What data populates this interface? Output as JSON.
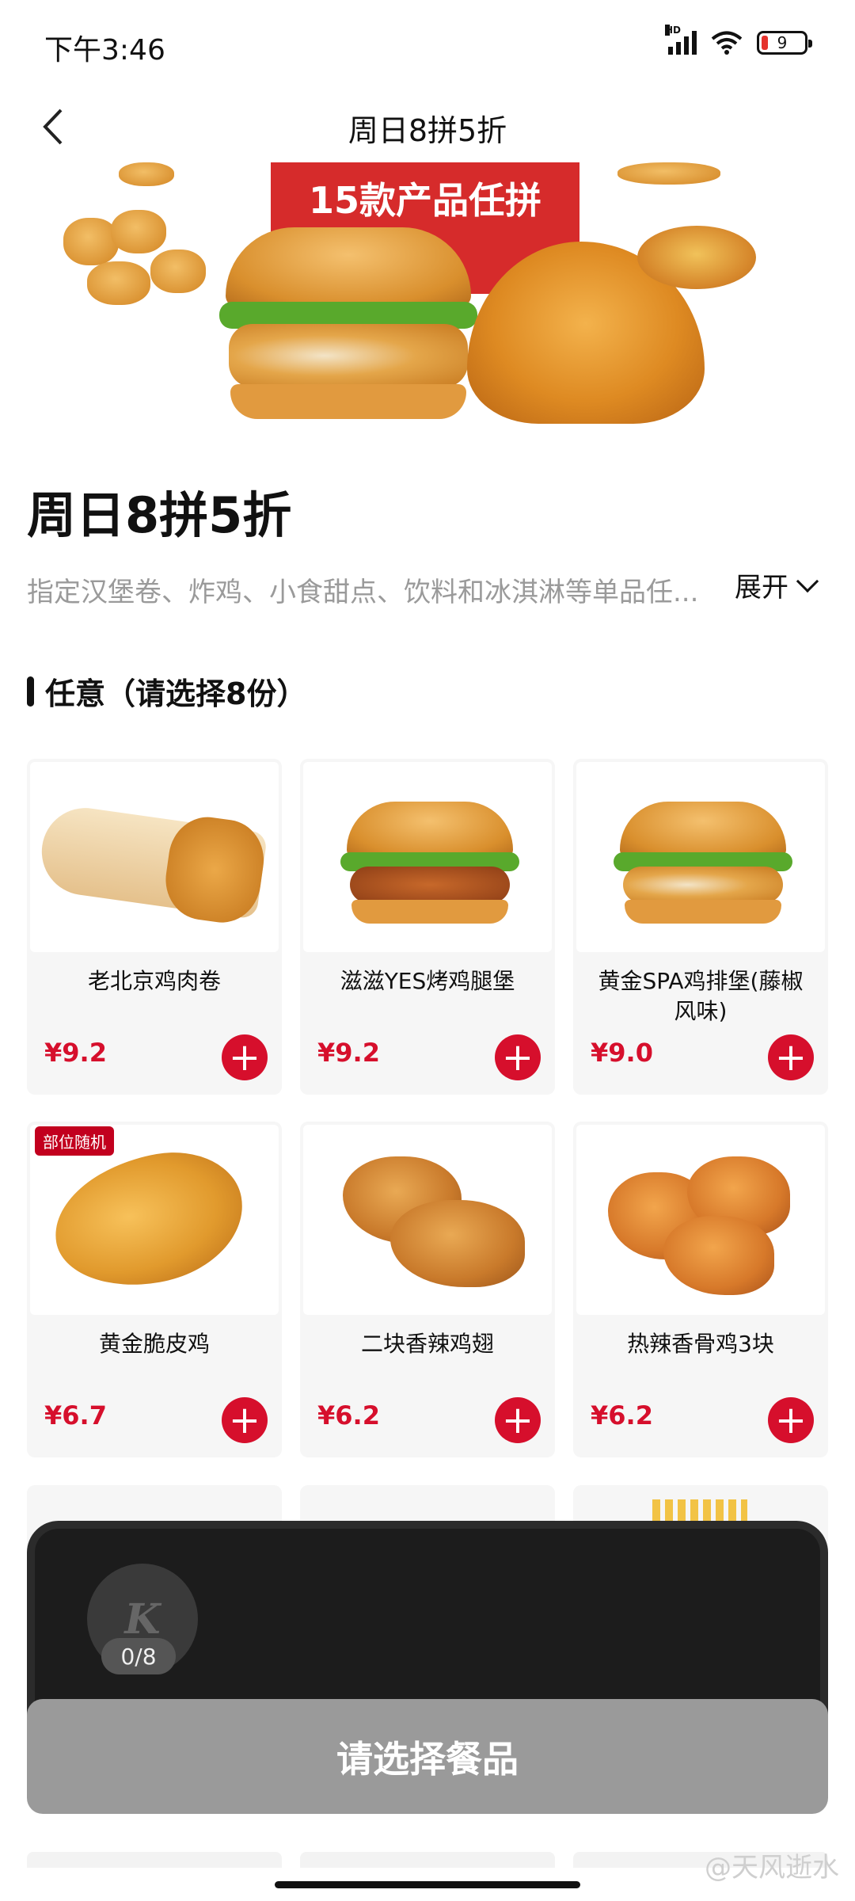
{
  "status_bar": {
    "time": "下午3:46",
    "network": "HD",
    "battery": "9"
  },
  "nav": {
    "title": "周日8拼5折"
  },
  "banner": {
    "tag": "15款产品任拼"
  },
  "promo": {
    "title": "周日8拼5折",
    "description": "指定汉堡卷、炸鸡、小食甜点、饮料和冰淇淋等单品任...",
    "expand_label": "展开"
  },
  "section": {
    "title": "任意（请选择8份）"
  },
  "products": [
    {
      "name": "老北京鸡肉卷",
      "price": "¥9.2"
    },
    {
      "name": "滋滋YES烤鸡腿堡",
      "price": "¥9.2"
    },
    {
      "name": "黄金SPA鸡排堡(藤椒风味)",
      "price": "¥9.0"
    },
    {
      "name": "黄金脆皮鸡",
      "price": "¥6.7",
      "badge": "部位随机"
    },
    {
      "name": "二块香辣鸡翅",
      "price": "¥6.2"
    },
    {
      "name": "热辣香骨鸡3块",
      "price": "¥6.2"
    }
  ],
  "cart": {
    "logo": "K",
    "count": "0/8",
    "cta": "请选择餐品"
  },
  "watermark": "@天风逝水",
  "colors": {
    "accent": "#d60f2c",
    "cart_bg": "#1c1c1c",
    "cta_disabled": "#9a9a9a"
  }
}
